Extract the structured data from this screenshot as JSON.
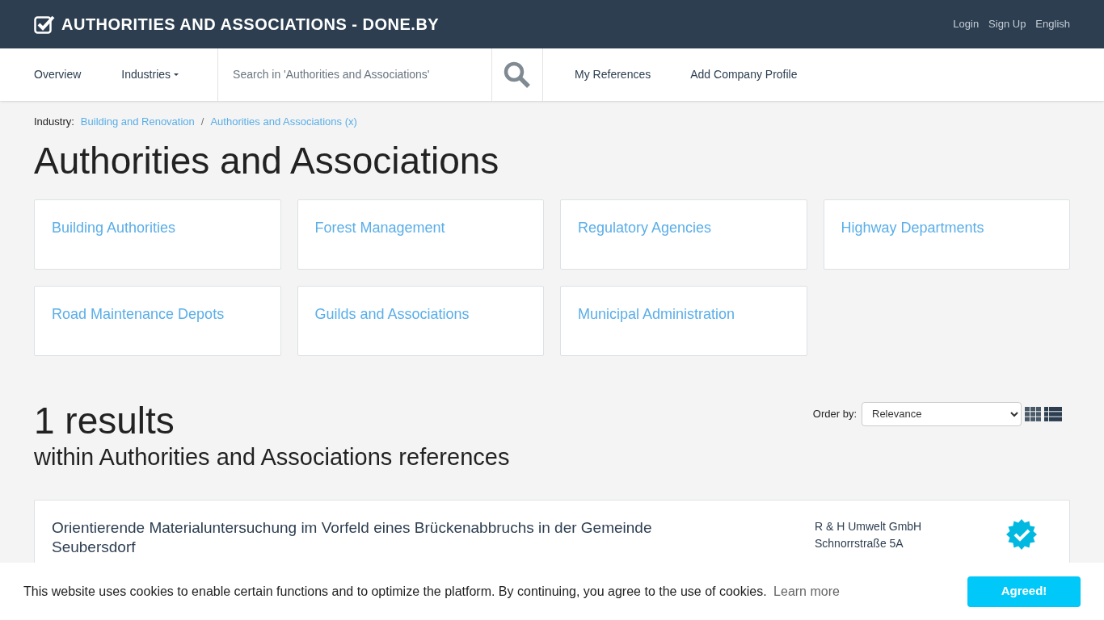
{
  "header": {
    "title": "AUTHORITIES AND ASSOCIATIONS - DONE.BY",
    "links": [
      "Login",
      "Sign Up",
      "English"
    ]
  },
  "nav": {
    "items": [
      {
        "label": "Overview",
        "dropdown": false
      },
      {
        "label": "Industries",
        "dropdown": true
      }
    ],
    "search": {
      "placeholder": "Search in 'Authorities and Associations'"
    },
    "right_items": [
      "My References",
      "Add Company Profile"
    ]
  },
  "breadcrumb": {
    "label": "Industry:",
    "separator": "/",
    "items": [
      "Building and Renovation",
      "Authorities and Associations (x)"
    ]
  },
  "page_title": "Authorities and Associations",
  "categories": [
    {
      "label": "Building Authorities"
    },
    {
      "label": "Forest Management"
    },
    {
      "label": "Regulatory Agencies"
    },
    {
      "label": "Highway Departments"
    },
    {
      "label": "Road Maintenance Depots"
    },
    {
      "label": "Guilds and Associations"
    },
    {
      "label": "Municipal Administration"
    }
  ],
  "results": {
    "count": "1 results",
    "subtitle": "within Authorities and Associations references",
    "order_label": "Order by:",
    "order_value": "Relevance",
    "views": [
      {
        "kind": "grid",
        "selected": false
      },
      {
        "kind": "list",
        "selected": true
      }
    ]
  },
  "result_items": [
    {
      "title": "Orientierende Materialuntersuchung im Vorfeld eines Brückenabbruchs in der Gemeinde Seubersdorf",
      "company": [
        "R & H Umwelt GmbH",
        "Schnorrstraße 5A"
      ],
      "verified": true
    }
  ],
  "cookie": {
    "text": "This website uses cookies to enable certain functions and to optimize the platform. By continuing, you agree to the use of cookies.",
    "link": "Learn more",
    "button": "Agreed!"
  }
}
